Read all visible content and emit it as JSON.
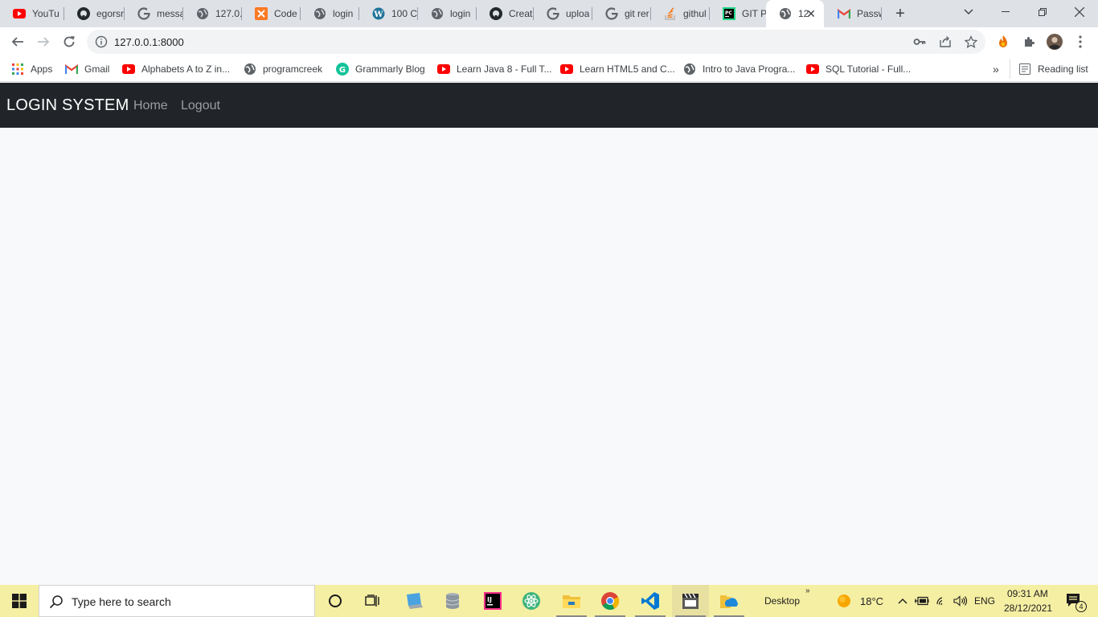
{
  "browser": {
    "tabs": [
      {
        "label": "YouTu",
        "icon": "youtube-icon"
      },
      {
        "label": "egorsr",
        "icon": "github-icon"
      },
      {
        "label": "messa",
        "icon": "google-icon"
      },
      {
        "label": "127.0.",
        "icon": "globe-icon"
      },
      {
        "label": "Code",
        "icon": "xampp-icon"
      },
      {
        "label": "login",
        "icon": "globe-icon"
      },
      {
        "label": "100 C",
        "icon": "wordpress-icon"
      },
      {
        "label": "login",
        "icon": "globe-icon"
      },
      {
        "label": "Create",
        "icon": "github-icon"
      },
      {
        "label": "uploa",
        "icon": "google-icon"
      },
      {
        "label": "git rer",
        "icon": "google-icon"
      },
      {
        "label": "githul",
        "icon": "stackoverflow-icon"
      },
      {
        "label": "GIT Pu",
        "icon": "pycharm-icon"
      },
      {
        "label": "12",
        "icon": "globe-icon",
        "active": true
      },
      {
        "label": "Passw",
        "icon": "gmail-icon"
      }
    ],
    "new_tab_symbol": "+",
    "url": "127.0.0.1:8000",
    "bookmarks": [
      {
        "label": "Apps",
        "icon": "apps-grid-icon"
      },
      {
        "label": "Gmail",
        "icon": "gmail-icon"
      },
      {
        "label": "Alphabets A to Z in...",
        "icon": "youtube-icon"
      },
      {
        "label": "programcreek",
        "icon": "globe-icon"
      },
      {
        "label": "Grammarly Blog",
        "icon": "grammarly-icon"
      },
      {
        "label": "Learn Java 8 - Full T...",
        "icon": "youtube-icon"
      },
      {
        "label": "Learn HTML5 and C...",
        "icon": "youtube-icon"
      },
      {
        "label": "Intro to Java Progra...",
        "icon": "globe-icon"
      },
      {
        "label": "SQL Tutorial - Full...",
        "icon": "youtube-icon"
      }
    ],
    "bookmarks_overflow": "»",
    "reading_list": "Reading list"
  },
  "page": {
    "brand": "LOGIN SYSTEM",
    "nav": {
      "home": "Home",
      "logout": "Logout"
    }
  },
  "taskbar": {
    "search_placeholder": "Type here to search",
    "desktop_label": "Desktop",
    "desktop_chevron": "»",
    "weather": "18°C",
    "language": "ENG",
    "time": "09:31 AM",
    "date": "28/12/2021",
    "notification_count": "4"
  },
  "colors": {
    "navbar_bg": "#212529",
    "page_bg": "#f8f9fa",
    "taskbar_bg": "#f5efa3"
  }
}
